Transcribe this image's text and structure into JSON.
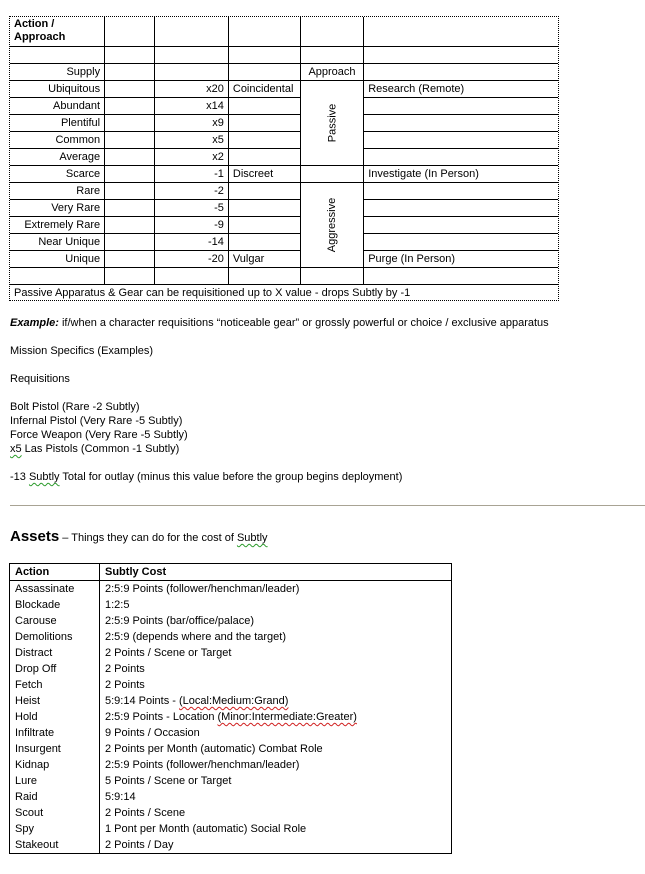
{
  "supply_table": {
    "header": {
      "action_approach": "Action /\nApproach"
    },
    "supply_label": "Supply",
    "approach_label": "Approach",
    "rows": [
      {
        "supply": "Ubiquitous",
        "value": "x20",
        "subtlety": "Coincidental",
        "action": "Research (Remote)"
      },
      {
        "supply": "Abundant",
        "value": "x14",
        "subtlety": "",
        "action": ""
      },
      {
        "supply": "Plentiful",
        "value": "x9",
        "subtlety": "",
        "action": ""
      },
      {
        "supply": "Common",
        "value": "x5",
        "subtlety": "",
        "action": ""
      },
      {
        "supply": "Average",
        "value": "x2",
        "subtlety": "",
        "action": ""
      },
      {
        "supply": "Scarce",
        "value": "-1",
        "subtlety": "Discreet",
        "action": "Investigate  (In Person)"
      },
      {
        "supply": "Rare",
        "value": "-2",
        "subtlety": "",
        "action": ""
      },
      {
        "supply": "Very Rare",
        "value": "-5",
        "subtlety": "",
        "action": ""
      },
      {
        "supply": "Extremely Rare",
        "value": "-9",
        "subtlety": "",
        "action": ""
      },
      {
        "supply": "Near Unique",
        "value": "-14",
        "subtlety": "",
        "action": ""
      },
      {
        "supply": "Unique",
        "value": "-20",
        "subtlety": "Vulgar",
        "action": "Purge (In Person)"
      }
    ],
    "approach_groups": {
      "passive": "Passive",
      "aggressive": "Aggressive"
    },
    "note": "Passive Apparatus & Gear can be requisitioned up to X value - drops Subtly by -1"
  },
  "example": {
    "label": "Example:",
    "text": " if/when a character requisitions “noticeable gear” or grossly powerful or choice / exclusive apparatus"
  },
  "mission_specifics": "Mission Specifics (Examples)",
  "requisitions": {
    "title": "Requisitions",
    "items": [
      "Bolt Pistol (Rare -2 Subtly)",
      "Infernal Pistol (Very Rare -5 Subtly)",
      "Force Weapon (Very Rare -5 Subtly)"
    ],
    "last_item_prefix": "x5",
    "last_item_rest": " Las Pistols (Common -1 Subtly)",
    "total_prefix": "-13 ",
    "total_word": "Subtly",
    "total_rest": " Total for outlay (minus this value before the group begins deployment)"
  },
  "assets": {
    "title": "Assets",
    "subtitle_prefix": " – Things they can do for the cost of ",
    "subtitle_word": "Subtly",
    "columns": [
      "Action",
      "Subtly Cost"
    ],
    "rows": [
      {
        "action": "Assassinate",
        "cost": "2:5:9 Points (follower/henchman/leader)"
      },
      {
        "action": "Blockade",
        "cost": "1:2:5"
      },
      {
        "action": "Carouse",
        "cost": "2:5:9 Points (bar/office/palace)"
      },
      {
        "action": "Demolitions",
        "cost": "2:5:9 (depends where and the target)"
      },
      {
        "action": "Distract",
        "cost": "2 Points / Scene or Target"
      },
      {
        "action": "Drop Off",
        "cost": "2 Points"
      },
      {
        "action": "Fetch",
        "cost": "2 Points"
      },
      {
        "action": "Heist",
        "cost": "5:9:14 Points - (Local:Medium:Grand)"
      },
      {
        "action": "Hold",
        "cost": "2:5:9 Points - Location (Minor:Intermediate:Greater)"
      },
      {
        "action": "Infiltrate",
        "cost": "9 Points / Occasion"
      },
      {
        "action": "Insurgent",
        "cost": "2 Points per Month (automatic) Combat Role"
      },
      {
        "action": "Kidnap",
        "cost": "2:5:9 Points (follower/henchman/leader)"
      },
      {
        "action": "Lure",
        "cost": "5 Points / Scene or Target"
      },
      {
        "action": "Raid",
        "cost": "5:9:14"
      },
      {
        "action": "Scout",
        "cost": "2 Points / Scene"
      },
      {
        "action": "Spy",
        "cost": "1 Pont per Month (automatic) Social Role"
      },
      {
        "action": "Stakeout",
        "cost": "2 Points / Day"
      }
    ],
    "heist_prefix": "5:9:14 Points - ",
    "heist_marked": "(Local:Medium:Grand)",
    "hold_prefix": "2:5:9 Points - Location ",
    "hold_marked": "(Minor:Intermediate:Greater)"
  }
}
